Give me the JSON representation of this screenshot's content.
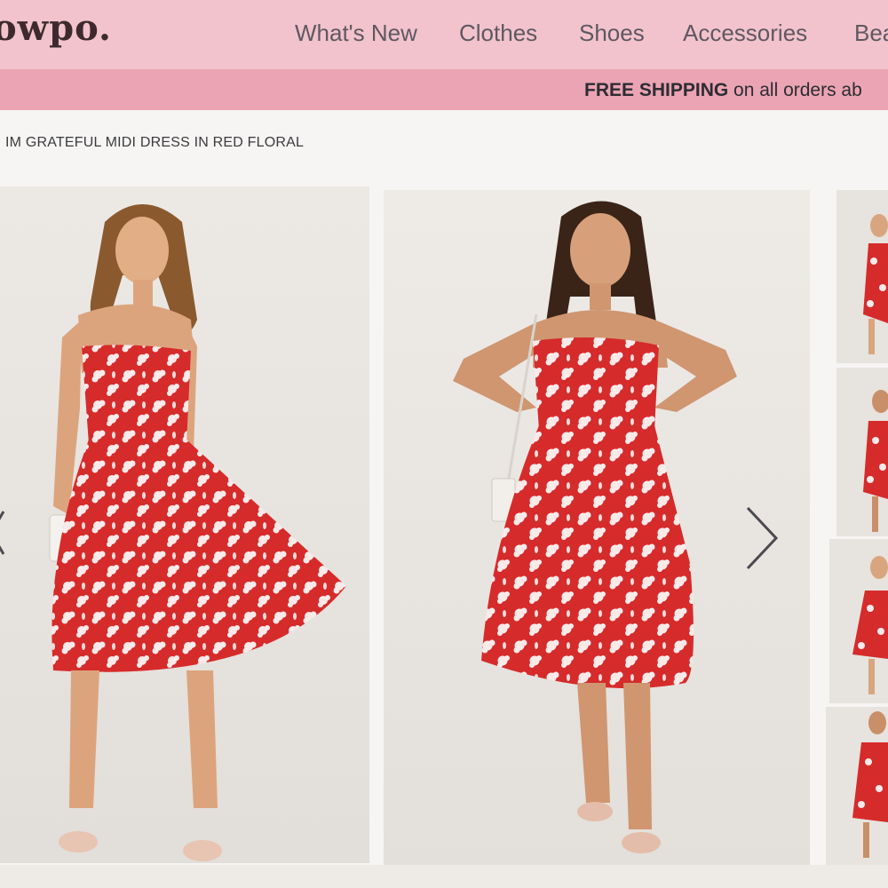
{
  "brand": {
    "logo_text": "owpo."
  },
  "nav": {
    "items": [
      {
        "label": "What's New"
      },
      {
        "label": "Clothes"
      },
      {
        "label": "Shoes"
      },
      {
        "label": "Accessories"
      },
      {
        "label": "Bea"
      }
    ]
  },
  "promo": {
    "bold": "FREE SHIPPING",
    "rest": " on all orders ab"
  },
  "product": {
    "breadcrumb": "IM GRATEFUL MIDI DRESS IN RED FLORAL"
  },
  "gallery": {
    "images": [
      {
        "subject": "model-1-red-floral-dress"
      },
      {
        "subject": "model-2-red-floral-dress"
      }
    ],
    "thumbnails": [
      {
        "subject": "thumbnail-1"
      },
      {
        "subject": "thumbnail-2"
      },
      {
        "subject": "thumbnail-3"
      },
      {
        "subject": "thumbnail-4"
      }
    ],
    "icons": {
      "prev": "chevron-left-icon",
      "next": "chevron-right-icon"
    }
  },
  "colors": {
    "header_bg": "#f2c3cc",
    "promo_bg": "#eba4b3",
    "logo": "#3e2a2e",
    "dress_red": "#d62b2b",
    "nav_text": "#5f5862"
  }
}
